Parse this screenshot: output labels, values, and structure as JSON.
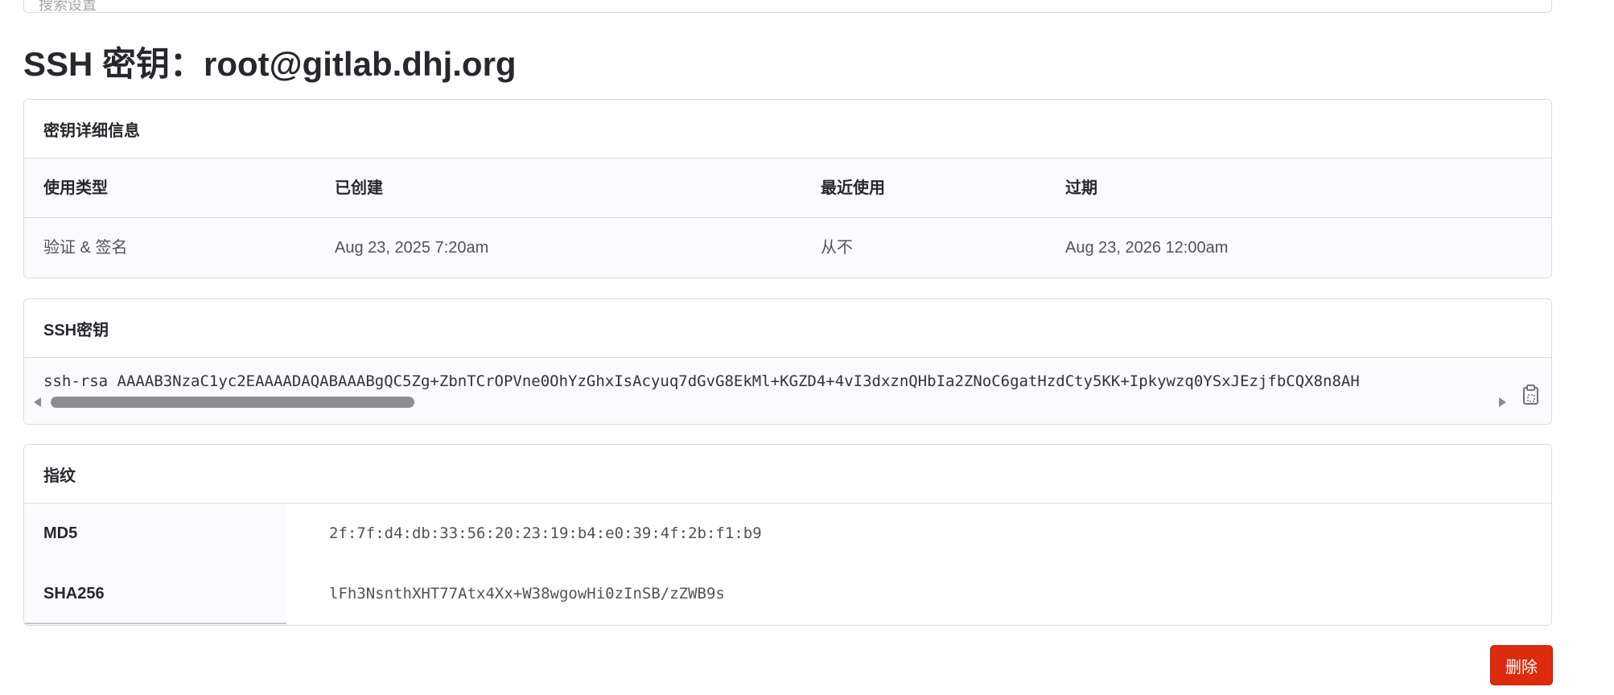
{
  "top_field": {
    "text": "搜索设置"
  },
  "title": "SSH 密钥：root@gitlab.dhj.org",
  "details": {
    "header": "密钥详细信息",
    "columns": [
      "使用类型",
      "已创建",
      "最近使用",
      "过期"
    ],
    "values": [
      "验证 & 签名",
      "Aug 23, 2025 7:20am",
      "从不",
      "Aug 23, 2026 12:00am"
    ]
  },
  "ssh_key": {
    "header": "SSH密钥",
    "value": "ssh-rsa AAAAB3NzaC1yc2EAAAADAQABAAABgQC5Zg+ZbnTCrOPVne0OhYzGhxIsAcyuq7dGvG8EkMl+KGZD4+4vI3dxznQHbIa2ZNoC6gatHzdCty5KK+Ipkywzq0YSxJEzjfbCQX8n8AH",
    "copy_icon": "clipboard-icon"
  },
  "fingerprints": {
    "header": "指纹",
    "rows": [
      {
        "label": "MD5",
        "value": "2f:7f:d4:db:33:56:20:23:19:b4:e0:39:4f:2b:f1:b9"
      },
      {
        "label": "SHA256",
        "value": "lFh3NsnthXHT77Atx4Xx+W38wgowHi0zInSB/zZWB9s"
      }
    ]
  },
  "actions": {
    "delete_label": "删除",
    "delete_color": "#dd2b0e"
  }
}
